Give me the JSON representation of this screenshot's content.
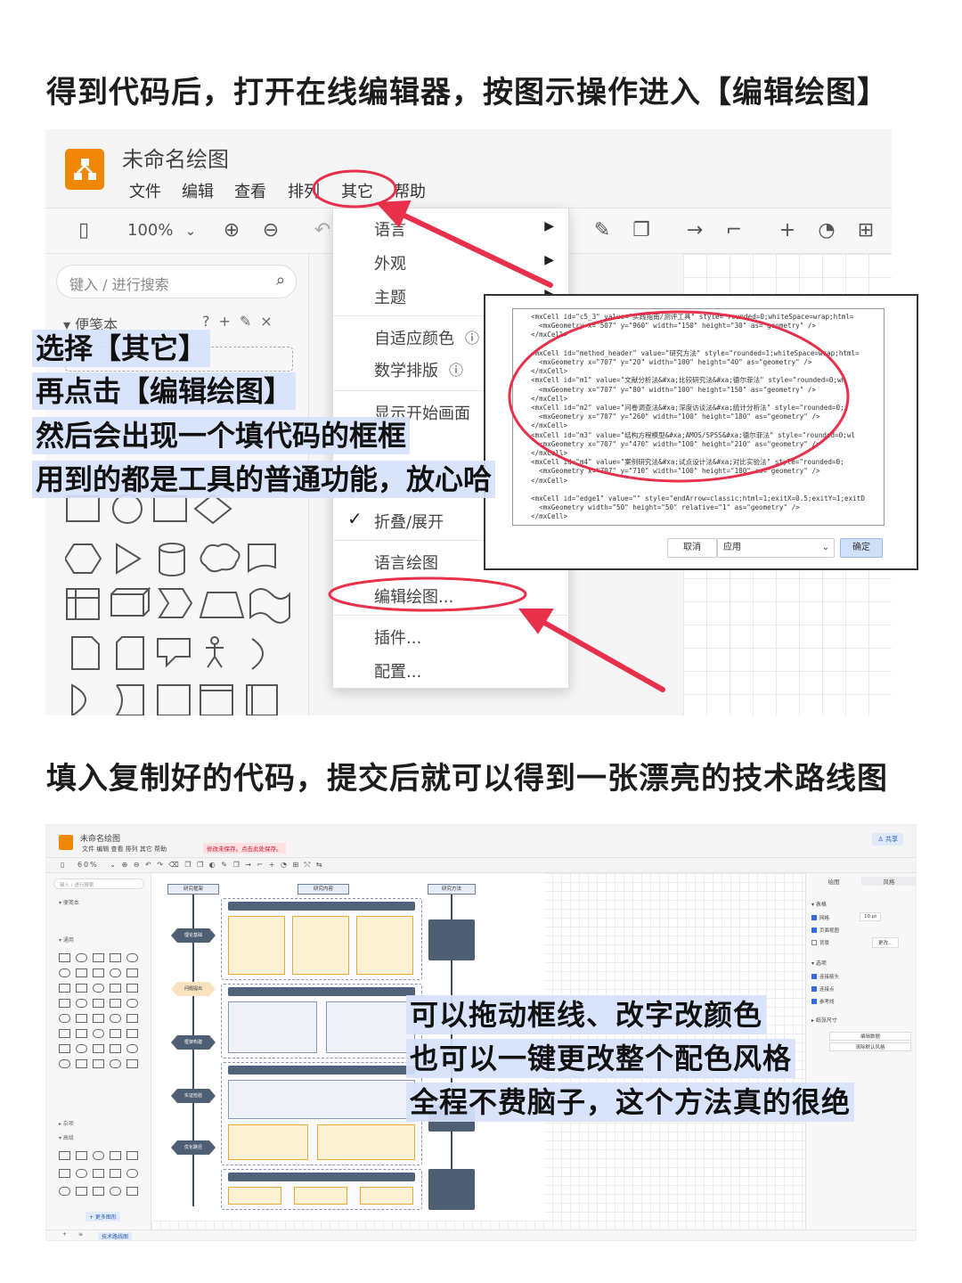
{
  "headings": {
    "first": "得到代码后，打开在线编辑器，按图示操作进入【编辑绘图】",
    "second": "填入复制好的代码，提交后就可以得到一张漂亮的技术路线图"
  },
  "screenshot1": {
    "app_title": "未命名绘图",
    "menu": [
      "文件",
      "编辑",
      "查看",
      "排列",
      "其它",
      "帮助"
    ],
    "zoom": "100%",
    "search_placeholder": "键入 / 进行搜索",
    "scratchpad": "便笺本",
    "dropdown": {
      "items": [
        {
          "label": "语言",
          "submenu": true
        },
        {
          "label": "外观",
          "submenu": true
        },
        {
          "label": "主题",
          "submenu": true
        },
        {
          "label": "自适应颜色",
          "help": true
        },
        {
          "label": "数学排版",
          "help": true
        },
        {
          "label": "显示开始画面"
        },
        {
          "label": "折叠/展开",
          "checked": true
        },
        {
          "label": "语言绘图"
        },
        {
          "label": "编辑绘图..."
        },
        {
          "label": "插件..."
        },
        {
          "label": "配置..."
        }
      ]
    },
    "codebox": {
      "lines": [
        "<mxCell id=\"c5_3\" value=\"实践指南/测评工具\" style=\"rounded=0;whiteSpace=wrap;html=",
        "  <mxGeometry x=\"507\" y=\"960\" width=\"150\" height=\"30\" as=\"geometry\" />",
        "</mxCell>",
        "",
        "<mxCell id=\"method_header\" value=\"研究方法\" style=\"rounded=1;whiteSpace=wrap;html=",
        "  <mxGeometry x=\"707\" y=\"20\" width=\"100\" height=\"40\" as=\"geometry\" />",
        "</mxCell>",
        "<mxCell id=\"m1\" value=\"文献分析法&#xa;比较研究法&#xa;德尔菲法\" style=\"rounded=0;wh",
        "  <mxGeometry x=\"707\" y=\"80\" width=\"100\" height=\"150\" as=\"geometry\" />",
        "</mxCell>",
        "<mxCell id=\"m2\" value=\"问卷调查法&#xa;深度访谈法&#xa;统计分析法\" style=\"rounded=0;",
        "  <mxGeometry x=\"707\" y=\"260\" width=\"100\" height=\"180\" as=\"geometry\" />",
        "</mxCell>",
        "<mxCell id=\"m3\" value=\"结构方程模型&#xa;AMOS/SPSS&#xa;德尔菲法\" style=\"rounded=0;wl",
        "  <mxGeometry x=\"707\" y=\"470\" width=\"100\" height=\"210\" as=\"geometry\" />",
        "</mxCell>",
        "<mxCell id=\"m4\" value=\"案例研究法&#xa;试点设计法&#xa;对比实验法\" style=\"rounded=0;",
        "  <mxGeometry x=\"707\" y=\"710\" width=\"100\" height=\"180\" as=\"geometry\" />",
        "</mxCell>",
        "",
        "<mxCell id=\"edge1\" value=\"\" style=\"endArrow=classic;html=1;exitX=0.5;exitY=1;exitD",
        "  <mxGeometry width=\"50\" height=\"50\" relative=\"1\" as=\"geometry\" />",
        "</mxCell>"
      ],
      "cancel": "取消",
      "mode": "应用",
      "ok": "确定"
    },
    "overlay": [
      "选择【其它】",
      "再点击【编辑绘图】",
      "然后会出现一个填代码的框框",
      "用到的都是工具的普通功能，放心哈"
    ]
  },
  "screenshot2": {
    "app_title": "未命名绘图",
    "menu": "文件  编辑  查看  排列  其它  帮助",
    "unsaved": "修改未保存。点击此处保存。",
    "share": "共享",
    "zoom": "60%",
    "search_placeholder": "键入 / 进行搜索",
    "scratchpad": "便笺本",
    "general": "通用",
    "misc": "杂项",
    "advanced": "高级",
    "more_shapes": "+ 更多图形",
    "page_tab": "技术路线图",
    "right_tabs": [
      "绘图",
      "风格"
    ],
    "right_sections": [
      "表格",
      "选项",
      "纸张尺寸"
    ],
    "right_options": [
      "网格",
      "页面视图",
      "背景",
      "连接箭头",
      "连接点",
      "参考线"
    ],
    "grid_size": "10 pt",
    "edit_button": "更改...",
    "buttons": [
      "编辑数据",
      "清除默认风格"
    ],
    "diagram": {
      "left_header": "研究框架",
      "mid_header": "研究内容",
      "right_header": "研究方法",
      "left_steps": [
        "理论基础",
        "问题提出",
        "框架构建",
        "实证检验",
        "优化路径"
      ]
    },
    "overlay": [
      "可以拖动框线、改字改颜色",
      "也可以一键更改整个配色风格",
      "全程不费脑子，这个方法真的很绝"
    ]
  },
  "colors": {
    "annotation_red": "#e8304a",
    "highlight": "#d6e2fc",
    "logo_orange": "#f08705"
  }
}
